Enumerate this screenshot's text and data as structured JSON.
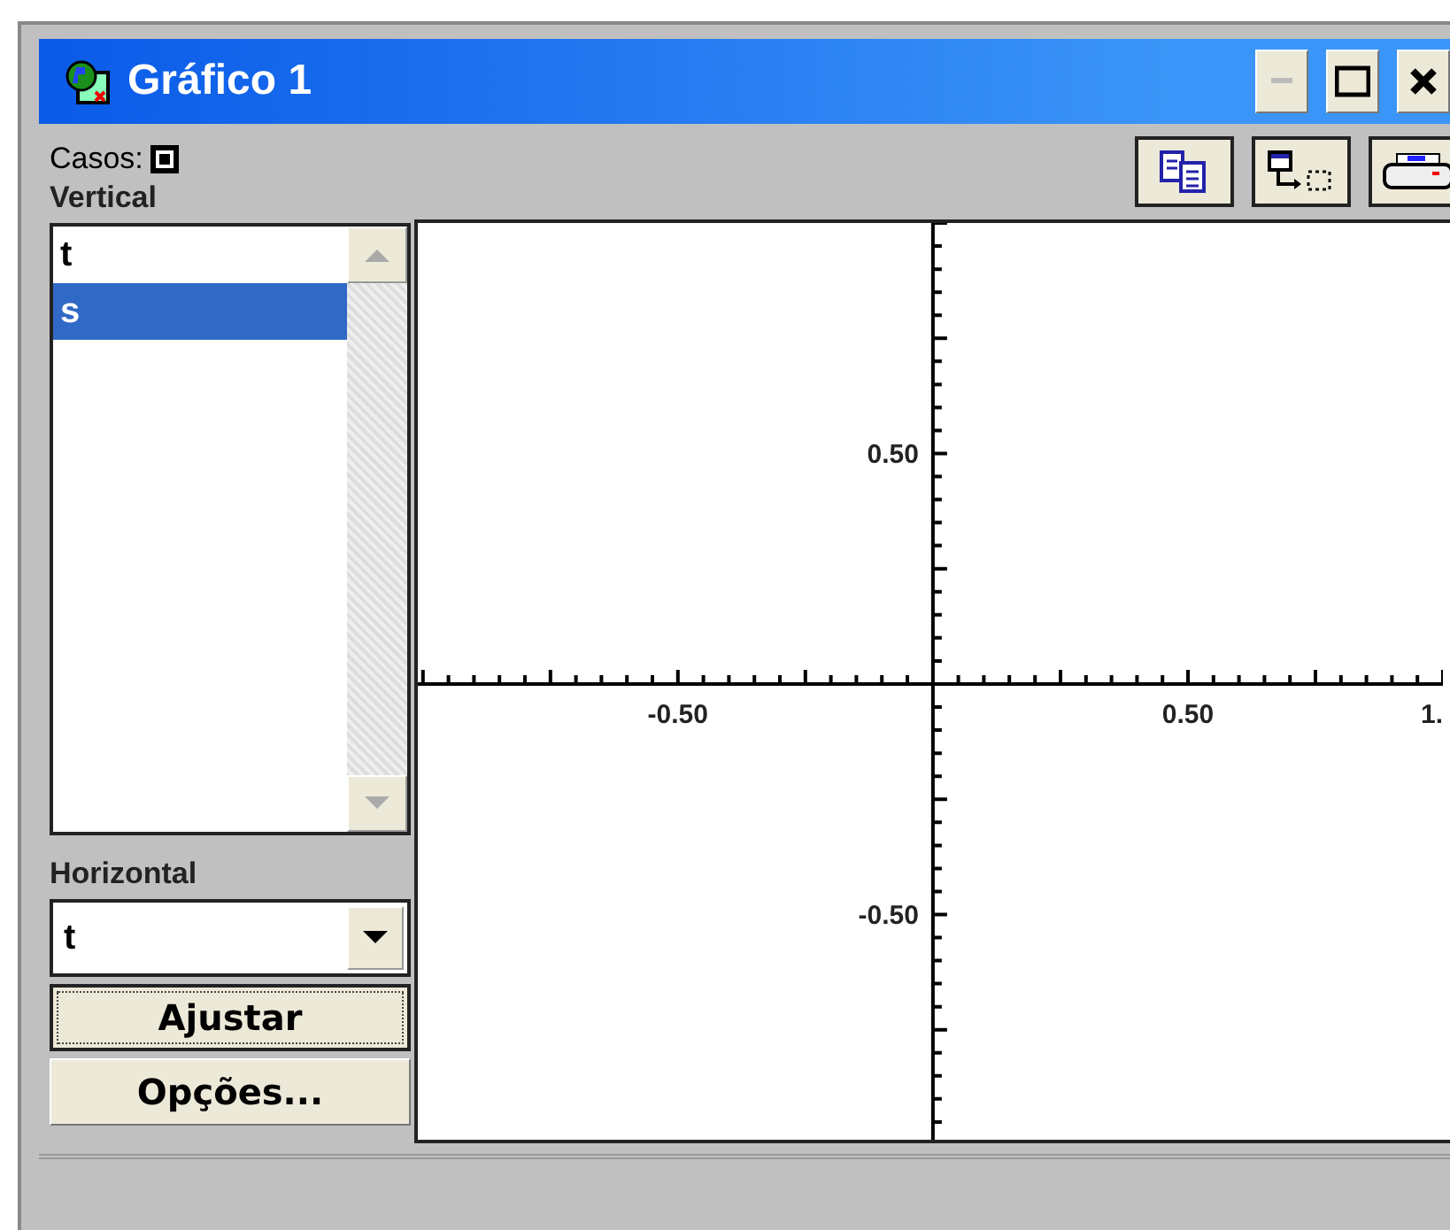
{
  "window": {
    "title": "Gráfico 1"
  },
  "toolbar": {
    "cases_label": "Casos:",
    "cases_checked": true
  },
  "vertical": {
    "label": "Vertical",
    "items": [
      {
        "label": "t",
        "selected": false
      },
      {
        "label": "s",
        "selected": true
      }
    ]
  },
  "horizontal": {
    "label": "Horizontal",
    "value": "t"
  },
  "buttons": [
    {
      "label": "Ajustar",
      "focused": true
    },
    {
      "label": "Opções...",
      "focused": false
    }
  ],
  "plot": {
    "chart_data": {
      "type": "line",
      "xlim": [
        -1.01,
        1.0
      ],
      "ylim": [
        -1.0,
        1.0
      ],
      "xticks": [
        {
          "value": -0.5,
          "label": "-0.50"
        },
        {
          "value": 0.5,
          "label": "0.50"
        },
        {
          "value": 1.0,
          "label": "1."
        }
      ],
      "yticks": [
        {
          "value": 0.5,
          "label": "0.50"
        },
        {
          "value": -0.5,
          "label": "-0.50"
        }
      ]
    }
  }
}
